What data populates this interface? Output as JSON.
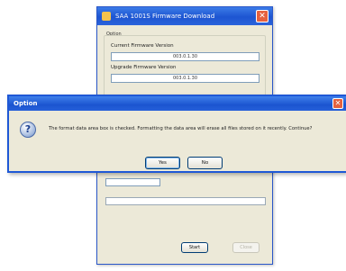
{
  "firmware_window": {
    "title": "SAA 1001S Firmware Download",
    "close_glyph": "✕",
    "option_group_label": "Option",
    "current_version_label": "Current Firmware Version",
    "current_version_value": "003.0.1.30",
    "upgrade_version_label": "Upgrade Firmware Version",
    "upgrade_version_value": "003.0.1.30",
    "start_button": "Start",
    "close_button": "Close"
  },
  "dialog": {
    "title": "Option",
    "close_glyph": "✕",
    "icon": "question-icon",
    "icon_glyph": "?",
    "message": "The format data area box is checked. Formatting the data area will erase all files stored on it recently. Continue?",
    "yes_button": "Yes",
    "no_button": "No"
  }
}
